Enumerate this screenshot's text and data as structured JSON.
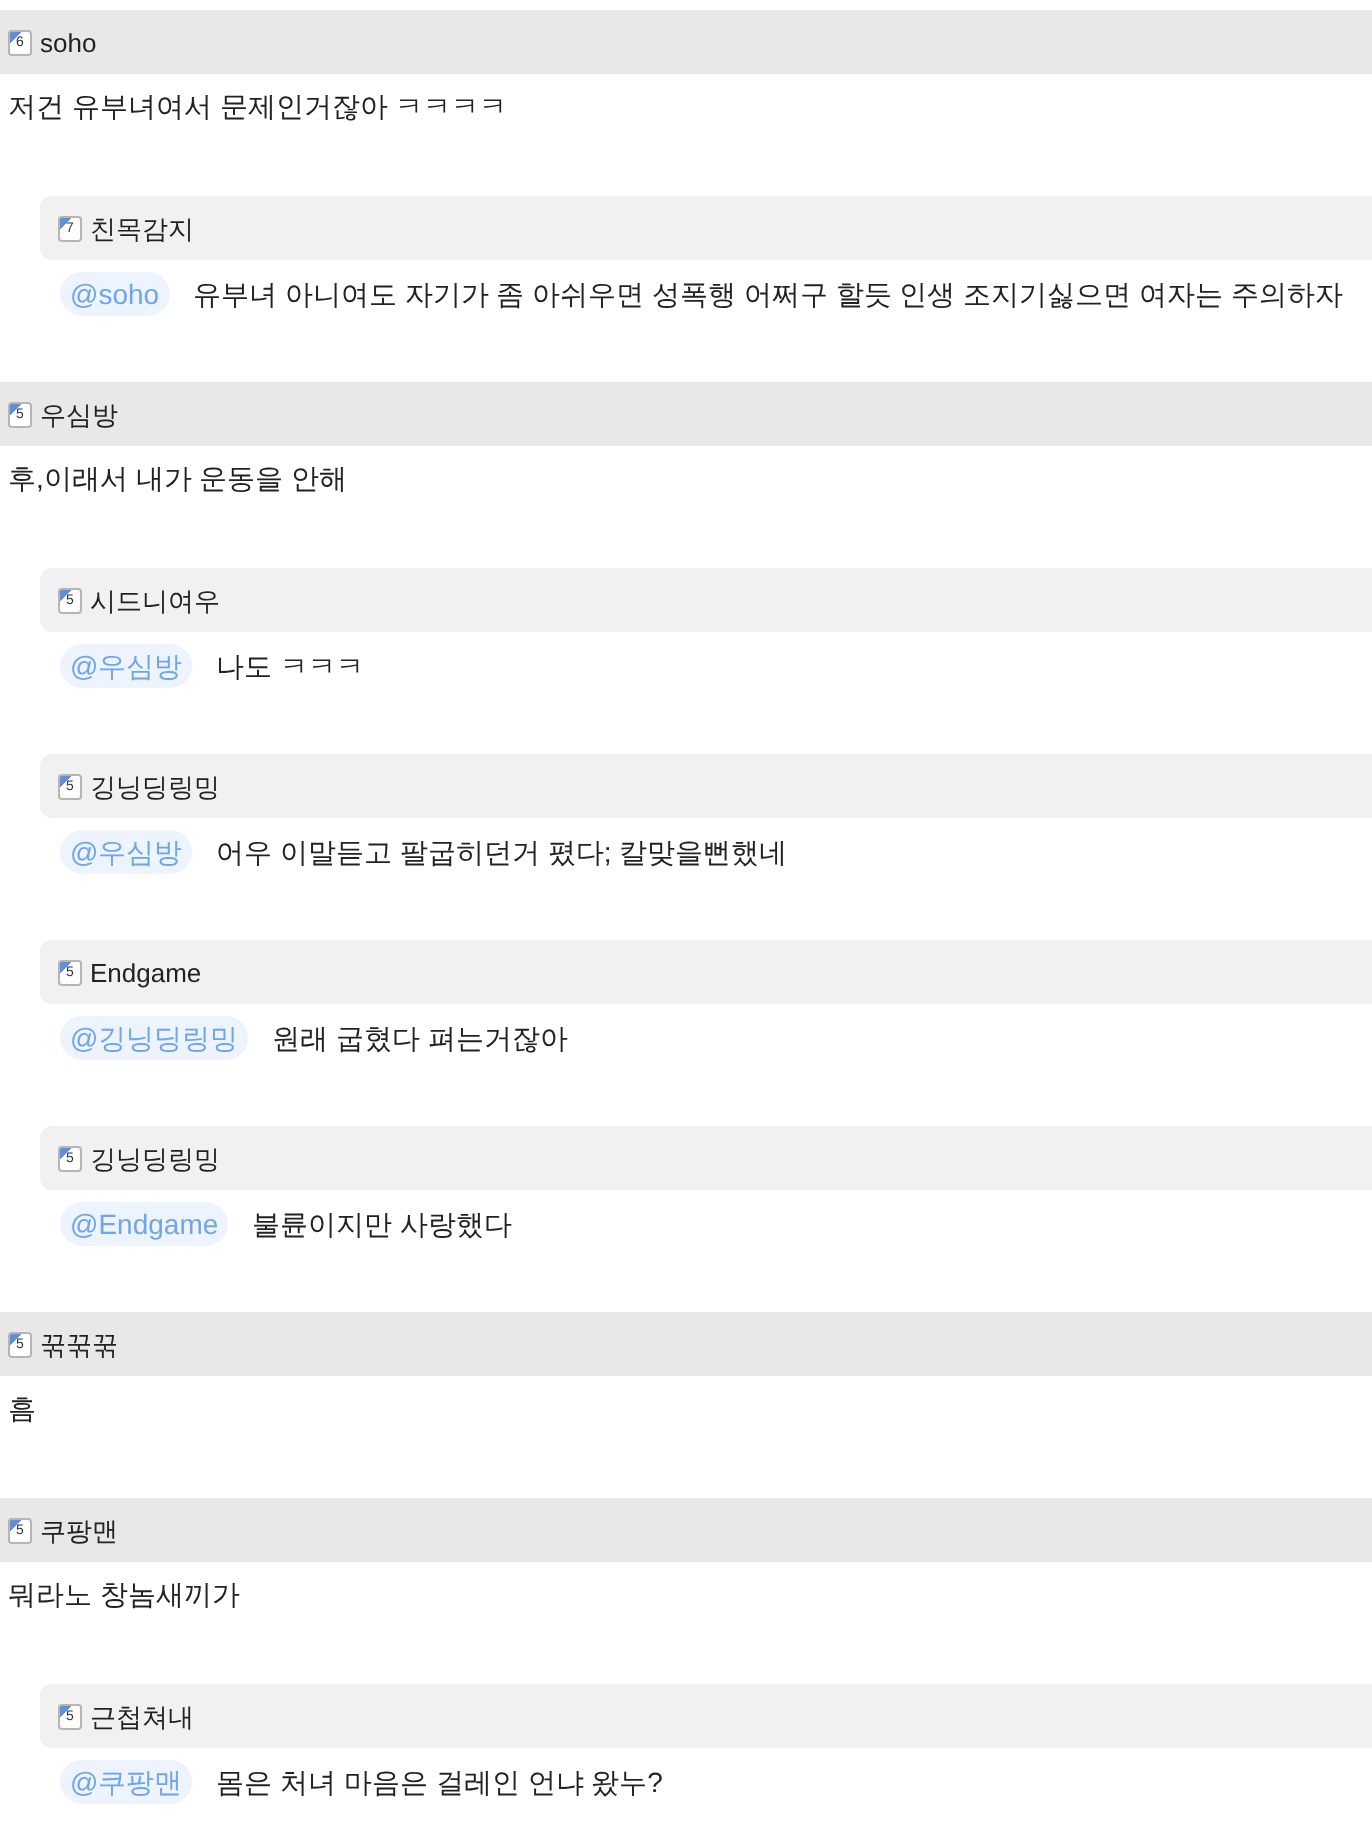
{
  "comments": [
    {
      "rank": "6",
      "author": "soho",
      "text": "저건 유부녀여서 문제인거잖아 ㅋㅋㅋㅋ",
      "replies": [
        {
          "rank": "7",
          "author": "친목감지",
          "mention": "@soho",
          "text": "유부녀 아니여도 자기가 좀 아쉬우면 성폭행 어쩌구 할듯 인생 조지기싫으면 여자는 주의하자"
        }
      ]
    },
    {
      "rank": "5",
      "author": "우심방",
      "text": "후,이래서 내가 운동을 안해",
      "replies": [
        {
          "rank": "5",
          "author": "시드니여우",
          "mention": "@우심방",
          "text": "나도 ㅋㅋㅋ"
        },
        {
          "rank": "5",
          "author": "깅닝딩링밍",
          "mention": "@우심방",
          "text": "어우 이말듣고 팔굽히던거 폈다; 칼맞을뻔했네"
        },
        {
          "rank": "5",
          "author": "Endgame",
          "mention": "@깅닝딩링밍",
          "text": "원래 굽혔다 펴는거잖아"
        },
        {
          "rank": "5",
          "author": "깅닝딩링밍",
          "mention": "@Endgame",
          "text": "불륜이지만 사랑했다"
        }
      ]
    },
    {
      "rank": "5",
      "author": "꾺꾺꾺",
      "text": "흠"
    },
    {
      "rank": "5",
      "author": "쿠팡맨",
      "text": "뭐라노 창놈새끼가",
      "replies": [
        {
          "rank": "5",
          "author": "근첩쳐내",
          "mention": "@쿠팡맨",
          "text": "몸은 처녀 마음은 걸레인 언냐 왔누?"
        }
      ]
    }
  ]
}
